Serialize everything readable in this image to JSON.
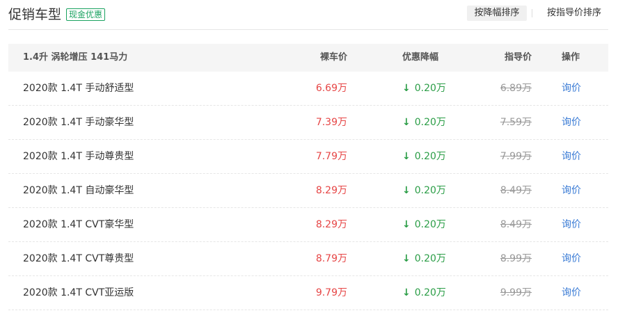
{
  "header": {
    "title": "促销车型",
    "badge": "现金优惠",
    "sort_by_discount": "按降幅排序",
    "sort_by_guide": "按指导价排序"
  },
  "table": {
    "columns": {
      "group": "1.4升 涡轮增压 141马力",
      "price": "裸车价",
      "discount": "优惠降幅",
      "guide": "指导价",
      "action": "操作"
    },
    "icons": {
      "discount": "arrow-down-icon"
    },
    "colors": {
      "price": "#e64545",
      "discount": "#2a9d46",
      "link": "#3a7bd5"
    },
    "rows": [
      {
        "name": "2020款 1.4T 手动舒适型",
        "price": "6.69万",
        "discount": "0.20万",
        "guide": "6.89万",
        "action": "询价"
      },
      {
        "name": "2020款 1.4T 手动豪华型",
        "price": "7.39万",
        "discount": "0.20万",
        "guide": "7.59万",
        "action": "询价"
      },
      {
        "name": "2020款 1.4T 手动尊贵型",
        "price": "7.79万",
        "discount": "0.20万",
        "guide": "7.99万",
        "action": "询价"
      },
      {
        "name": "2020款 1.4T 自动豪华型",
        "price": "8.29万",
        "discount": "0.20万",
        "guide": "8.49万",
        "action": "询价"
      },
      {
        "name": "2020款 1.4T CVT豪华型",
        "price": "8.29万",
        "discount": "0.20万",
        "guide": "8.49万",
        "action": "询价"
      },
      {
        "name": "2020款 1.4T CVT尊贵型",
        "price": "8.79万",
        "discount": "0.20万",
        "guide": "8.99万",
        "action": "询价"
      },
      {
        "name": "2020款 1.4T CVT亚运版",
        "price": "9.79万",
        "discount": "0.20万",
        "guide": "9.99万",
        "action": "询价"
      }
    ]
  }
}
